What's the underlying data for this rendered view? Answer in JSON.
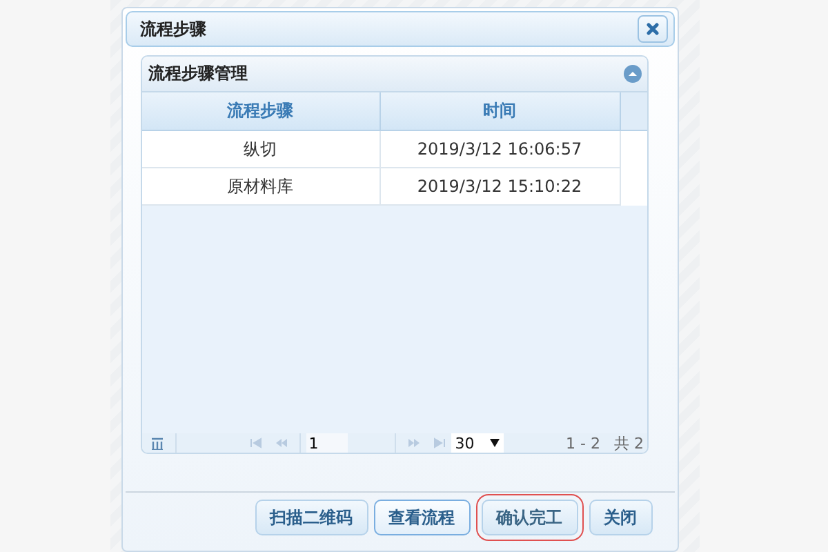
{
  "dialog": {
    "title": "流程步骤"
  },
  "panel": {
    "title": "流程步骤管理",
    "expanded": true
  },
  "table": {
    "columns": [
      "流程步骤",
      "时间"
    ],
    "rows": [
      [
        "纵切",
        "2019/3/12 16:06:57"
      ],
      [
        "原材料库",
        "2019/3/12 15:10:22"
      ]
    ]
  },
  "pager": {
    "page": "1",
    "page_size": "30",
    "range": "1 - 2",
    "total": "共 2"
  },
  "buttons": [
    {
      "label": "扫描二维码",
      "focused": false,
      "outlined": false
    },
    {
      "label": "查看流程",
      "focused": true,
      "outlined": false
    },
    {
      "label": "确认完工",
      "focused": false,
      "outlined": true
    },
    {
      "label": "关闭",
      "focused": false,
      "outlined": false
    }
  ]
}
